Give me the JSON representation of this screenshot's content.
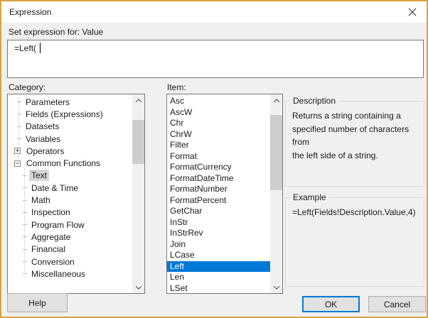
{
  "window": {
    "title": "Expression"
  },
  "header": {
    "set_expression_label": "Set expression for: Value"
  },
  "expression_editor": {
    "value": "=Left("
  },
  "category_panel": {
    "label": "Category:",
    "tree": [
      {
        "label": "Parameters",
        "level": 1,
        "expander": null,
        "selected": false
      },
      {
        "label": "Fields (Expressions)",
        "level": 1,
        "expander": null,
        "selected": false
      },
      {
        "label": "Datasets",
        "level": 1,
        "expander": null,
        "selected": false
      },
      {
        "label": "Variables",
        "level": 1,
        "expander": null,
        "selected": false
      },
      {
        "label": "Operators",
        "level": 1,
        "expander": "plus",
        "selected": false
      },
      {
        "label": "Common Functions",
        "level": 1,
        "expander": "minus",
        "selected": false
      },
      {
        "label": "Text",
        "level": 2,
        "expander": null,
        "selected": true
      },
      {
        "label": "Date & Time",
        "level": 2,
        "expander": null,
        "selected": false
      },
      {
        "label": "Math",
        "level": 2,
        "expander": null,
        "selected": false
      },
      {
        "label": "Inspection",
        "level": 2,
        "expander": null,
        "selected": false
      },
      {
        "label": "Program Flow",
        "level": 2,
        "expander": null,
        "selected": false
      },
      {
        "label": "Aggregate",
        "level": 2,
        "expander": null,
        "selected": false
      },
      {
        "label": "Financial",
        "level": 2,
        "expander": null,
        "selected": false
      },
      {
        "label": "Conversion",
        "level": 2,
        "expander": null,
        "selected": false
      },
      {
        "label": "Miscellaneous",
        "level": 2,
        "expander": null,
        "selected": false
      }
    ]
  },
  "item_panel": {
    "label": "Item:",
    "items": [
      "Asc",
      "AscW",
      "Chr",
      "ChrW",
      "Filter",
      "Format",
      "FormatCurrency",
      "FormatDateTime",
      "FormatNumber",
      "FormatPercent",
      "GetChar",
      "InStr",
      "InStrRev",
      "Join",
      "LCase",
      "Left",
      "Len",
      "LSet"
    ],
    "selected_item": "Left"
  },
  "description_panel": {
    "title": "Description",
    "text": "Returns a string containing a\nspecified number of characters from\nthe left side of a string."
  },
  "example_panel": {
    "title": "Example",
    "text": "=Left(Fields!Description.Value,4)"
  },
  "buttons": {
    "help": "Help",
    "ok": "OK",
    "cancel": "Cancel"
  },
  "colors": {
    "selection_accent": "#0078d7",
    "window_frame": "#d8a23c",
    "inactive_selection": "#d6d6d6",
    "dialog_background": "#f0f0f0"
  }
}
